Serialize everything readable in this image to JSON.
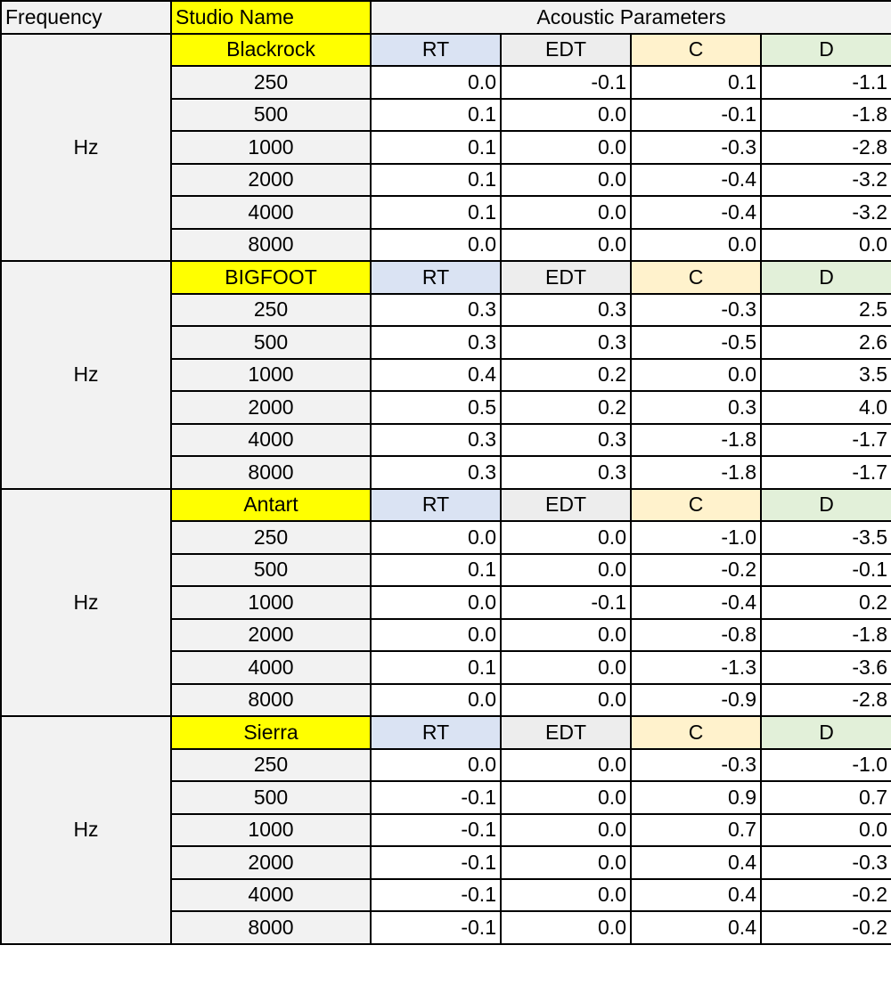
{
  "header": {
    "frequency_label": "Frequency",
    "studio_label": "Studio Name",
    "params_label": "Acoustic Parameters"
  },
  "param_labels": [
    "RT",
    "EDT",
    "C",
    "D"
  ],
  "colors": {
    "studio_highlight": "#ffff00",
    "rt_header": "#dae3f3",
    "edt_header": "#ededed",
    "c_header": "#fff2cc",
    "d_header": "#e2f0d9",
    "label_gray": "#f2f2f2"
  },
  "studios": [
    {
      "name": "Blackrock",
      "unit": "Hz",
      "rows": [
        {
          "band": "250",
          "rt": "0.0",
          "edt": "-0.1",
          "c": "0.1",
          "d": "-1.1"
        },
        {
          "band": "500",
          "rt": "0.1",
          "edt": "0.0",
          "c": "-0.1",
          "d": "-1.8"
        },
        {
          "band": "1000",
          "rt": "0.1",
          "edt": "0.0",
          "c": "-0.3",
          "d": "-2.8"
        },
        {
          "band": "2000",
          "rt": "0.1",
          "edt": "0.0",
          "c": "-0.4",
          "d": "-3.2"
        },
        {
          "band": "4000",
          "rt": "0.1",
          "edt": "0.0",
          "c": "-0.4",
          "d": "-3.2"
        },
        {
          "band": "8000",
          "rt": "0.0",
          "edt": "0.0",
          "c": "0.0",
          "d": "0.0"
        }
      ]
    },
    {
      "name": "BIGFOOT",
      "unit": "Hz",
      "rows": [
        {
          "band": "250",
          "rt": "0.3",
          "edt": "0.3",
          "c": "-0.3",
          "d": "2.5"
        },
        {
          "band": "500",
          "rt": "0.3",
          "edt": "0.3",
          "c": "-0.5",
          "d": "2.6"
        },
        {
          "band": "1000",
          "rt": "0.4",
          "edt": "0.2",
          "c": "0.0",
          "d": "3.5"
        },
        {
          "band": "2000",
          "rt": "0.5",
          "edt": "0.2",
          "c": "0.3",
          "d": "4.0"
        },
        {
          "band": "4000",
          "rt": "0.3",
          "edt": "0.3",
          "c": "-1.8",
          "d": "-1.7"
        },
        {
          "band": "8000",
          "rt": "0.3",
          "edt": "0.3",
          "c": "-1.8",
          "d": "-1.7"
        }
      ]
    },
    {
      "name": "Antart",
      "unit": "Hz",
      "rows": [
        {
          "band": "250",
          "rt": "0.0",
          "edt": "0.0",
          "c": "-1.0",
          "d": "-3.5"
        },
        {
          "band": "500",
          "rt": "0.1",
          "edt": "0.0",
          "c": "-0.2",
          "d": "-0.1"
        },
        {
          "band": "1000",
          "rt": "0.0",
          "edt": "-0.1",
          "c": "-0.4",
          "d": "0.2"
        },
        {
          "band": "2000",
          "rt": "0.0",
          "edt": "0.0",
          "c": "-0.8",
          "d": "-1.8"
        },
        {
          "band": "4000",
          "rt": "0.1",
          "edt": "0.0",
          "c": "-1.3",
          "d": "-3.6"
        },
        {
          "band": "8000",
          "rt": "0.0",
          "edt": "0.0",
          "c": "-0.9",
          "d": "-2.8"
        }
      ]
    },
    {
      "name": "Sierra",
      "unit": "Hz",
      "rows": [
        {
          "band": "250",
          "rt": "0.0",
          "edt": "0.0",
          "c": "-0.3",
          "d": "-1.0"
        },
        {
          "band": "500",
          "rt": "-0.1",
          "edt": "0.0",
          "c": "0.9",
          "d": "0.7"
        },
        {
          "band": "1000",
          "rt": "-0.1",
          "edt": "0.0",
          "c": "0.7",
          "d": "0.0"
        },
        {
          "band": "2000",
          "rt": "-0.1",
          "edt": "0.0",
          "c": "0.4",
          "d": "-0.3"
        },
        {
          "band": "4000",
          "rt": "-0.1",
          "edt": "0.0",
          "c": "0.4",
          "d": "-0.2"
        },
        {
          "band": "8000",
          "rt": "-0.1",
          "edt": "0.0",
          "c": "0.4",
          "d": "-0.2"
        }
      ]
    }
  ]
}
